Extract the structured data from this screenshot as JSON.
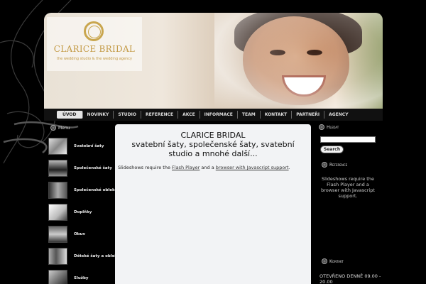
{
  "logo": {
    "title": "CLARICE BRIDAL",
    "subtitle": "the wedding studio & the wedding agency"
  },
  "nav": {
    "items": [
      {
        "label": "ÚVOD",
        "active": true
      },
      {
        "label": "NOVINKY"
      },
      {
        "label": "STUDIO"
      },
      {
        "label": "REFERENCE"
      },
      {
        "label": "AKCE"
      },
      {
        "label": "INFORMACE"
      },
      {
        "label": "TEAM"
      },
      {
        "label": "KONTAKT"
      },
      {
        "label": "PARTNEŘI"
      },
      {
        "label": "AGENCY"
      }
    ]
  },
  "sidebar": {
    "heading": "Menu",
    "items": [
      {
        "label": "Svatební šaty"
      },
      {
        "label": "Společenské šaty"
      },
      {
        "label": "Společenské obleky"
      },
      {
        "label": "Doplňky"
      },
      {
        "label": "Obuv"
      },
      {
        "label": "Dětské šaty a obleky"
      },
      {
        "label": "Služby"
      }
    ]
  },
  "main": {
    "title_line1": "CLARICE BRIDAL",
    "title_line2": "svatební šaty, společenské šaty, svatební studio a mnohé další...",
    "slides_prefix": "Slideshows require the ",
    "flash_link": "Flash Player",
    "slides_mid": " and a ",
    "js_link": "browser with Javascript support",
    "slides_suffix": "."
  },
  "right": {
    "search_heading": "Hledat",
    "search_button": "Search",
    "reference_heading": "Reference",
    "reference_text": "Slideshows require the Flash Player and a browser with Javascript support.",
    "kontakt_heading": "Kontakt",
    "kontakt_text": "OTEVŘENO DENNĚ 09.00 - 20.00"
  },
  "colors": {
    "background": "#000000",
    "content_bg": "#f2f3f5",
    "logo_gold": "#c39a45"
  }
}
